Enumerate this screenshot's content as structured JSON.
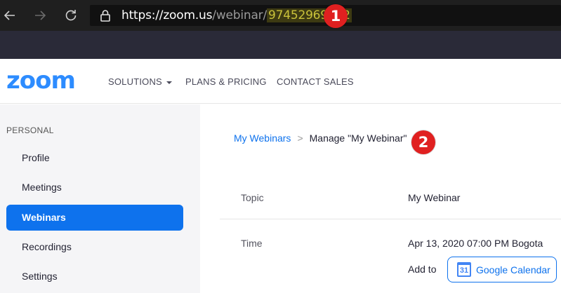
{
  "browser": {
    "url_host": "https://zoom.us",
    "url_path": "/webinar/",
    "url_id": "97452969492"
  },
  "annotations": [
    "1",
    "2"
  ],
  "header": {
    "logo": "zoom",
    "nav": [
      {
        "label": "SOLUTIONS",
        "has_caret": true
      },
      {
        "label": "PLANS & PRICING"
      },
      {
        "label": "CONTACT SALES"
      }
    ]
  },
  "sidebar": {
    "section": "PERSONAL",
    "items": [
      {
        "label": "Profile",
        "active": false
      },
      {
        "label": "Meetings",
        "active": false
      },
      {
        "label": "Webinars",
        "active": true
      },
      {
        "label": "Recordings",
        "active": false
      },
      {
        "label": "Settings",
        "active": false
      }
    ]
  },
  "breadcrumb": {
    "link": "My Webinars",
    "separator": ">",
    "current": "Manage \"My Webinar\""
  },
  "details": {
    "topic_label": "Topic",
    "topic_value": "My Webinar",
    "time_label": "Time",
    "time_value": "Apr 13, 2020 07:00 PM Bogota",
    "add_to_label": "Add to",
    "calendar_button": "Google Calendar",
    "calendar_icon_text": "31"
  },
  "colors": {
    "brand": "#2d8cff",
    "accent": "#0e72ed",
    "badge": "#e02020"
  }
}
